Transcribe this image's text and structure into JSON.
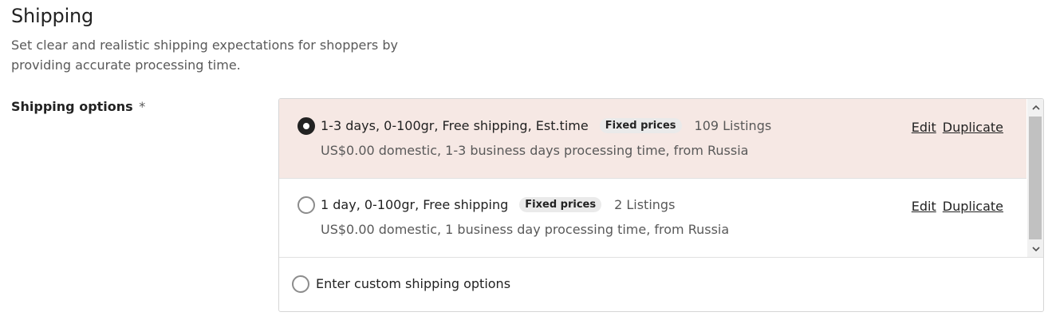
{
  "section": {
    "title": "Shipping",
    "description": "Set clear and realistic shipping expectations for shoppers by providing accurate processing time."
  },
  "field": {
    "label": "Shipping options",
    "required_marker": "*"
  },
  "options": [
    {
      "name": "1-3 days, 0-100gr, Free shipping, Est.time",
      "badge": "Fixed prices",
      "listings": "109 Listings",
      "summary": "US$0.00 domestic, 1-3 business days processing time, from Russia",
      "selected": true,
      "edit_label": "Edit",
      "duplicate_label": "Duplicate"
    },
    {
      "name": "1 day, 0-100gr, Free shipping",
      "badge": "Fixed prices",
      "listings": "2 Listings",
      "summary": "US$0.00 domestic, 1 business day processing time, from Russia",
      "selected": false,
      "edit_label": "Edit",
      "duplicate_label": "Duplicate"
    }
  ],
  "custom_option": {
    "label": "Enter custom shipping options",
    "selected": false
  },
  "colors": {
    "selected_row_bg": "#f6e8e4",
    "badge_bg": "#eaeaea",
    "text_primary": "#222222",
    "text_secondary": "#595959"
  },
  "icons": {
    "scroll_up": "chevron-up-icon",
    "scroll_down": "chevron-down-icon"
  }
}
